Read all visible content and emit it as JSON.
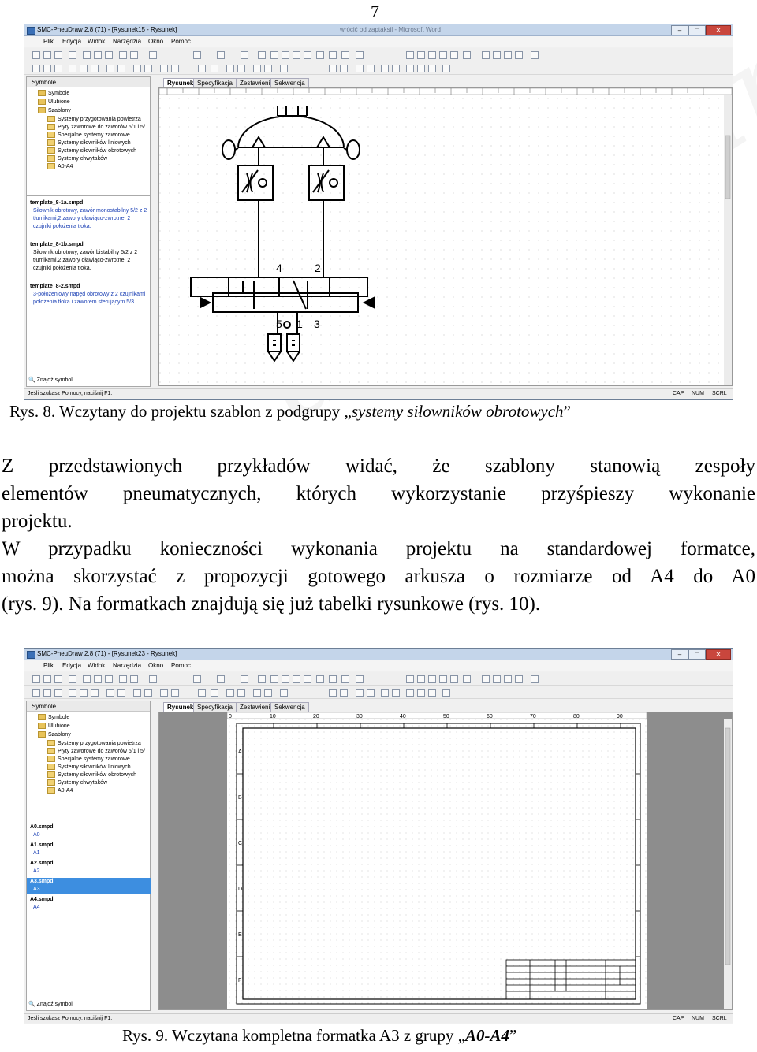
{
  "page_number": "7",
  "watermark": "abybaniarek",
  "figure1": {
    "title": "SMC-PneuDraw 2.8 (71) - [Rysunek15 - Rysunek]",
    "title_blurred": "wrócić od zaptaksil - Microsoft Word",
    "window_buttons": [
      "–",
      "□",
      "✕"
    ],
    "menu": [
      "Plik",
      "Edycja",
      "Widok",
      "Narzędzia",
      "Okno",
      "Pomoc"
    ],
    "panel_header": "Symbole",
    "tree_roots": [
      "Symbole",
      "Ulubione",
      "Szablony"
    ],
    "tree_children": [
      "Systemy przygotowania powietrza",
      "Płyty zaworowe do zaworów 5/1 i 5/",
      "Specjalne systemy zaworowe",
      "Systemy siłowników liniowych",
      "Systemy siłowników obrotowych",
      "Systemy chwytaków",
      "A0-A4"
    ],
    "templates": [
      {
        "file": "template_8-1a.smpd",
        "desc": "Siłownik obrotowy, zawór monostabilny 5/2 z 2 tłumikami,2 zawory dławiąco-zwrotne, 2 czujniki położenia tłoka."
      },
      {
        "file": "template_8-1b.smpd",
        "desc": "Siłownik obrotowy, zawór bistabilny 5/2 z 2 tłumikami,2 zawory dławiąco-zwrotne, 2 czujniki położenia tłoka."
      },
      {
        "file": "template_8-2.smpd",
        "desc": "3-położeniowy napęd obrotowy z 2 czujnikami położenia tłoka i zaworem sterującym 5/3."
      }
    ],
    "tabs": [
      "Rysunek",
      "Specyfikacja",
      "Zestawienie",
      "Sekwencja"
    ],
    "find_symbol": "Znajdź symbol",
    "status_help": "Jeśli szukasz Pomocy, naciśnij F1.",
    "status_flags": [
      "CAP",
      "NUM",
      "SCRL"
    ],
    "port_labels": {
      "p4": "4",
      "p2": "2",
      "p5": "5",
      "p1": "1",
      "p3": "3"
    }
  },
  "caption1": {
    "prefix": "Rys. 8. Wczytany do projektu szablon z podgrupy ",
    "open_quote": "„",
    "italic": "systemy siłowników obrotowych",
    "close_quote": "”"
  },
  "paragraph": {
    "lines": [
      "Z przedstawionych przykładów widać, że szablony stanowią zespoły",
      "elementów pneumatycznych, których wykorzystanie przyśpieszy wykonanie",
      "projektu.",
      "W przypadku konieczności wykonania projektu na standardowej formatce,",
      "można skorzystać z propozycji gotowego arkusza o rozmiarze od A4 do A0",
      "(rys. 9). Na formatkach znajdują się już tabelki rysunkowe (rys. 10)."
    ]
  },
  "figure2": {
    "title": "SMC-PneuDraw 2.8 (71) - [Rysunek23 - Rysunek]",
    "window_buttons": [
      "–",
      "□",
      "✕"
    ],
    "menu": [
      "Plik",
      "Edycja",
      "Widok",
      "Narzędzia",
      "Okno",
      "Pomoc"
    ],
    "panel_header": "Symbole",
    "tree_roots": [
      "Symbole",
      "Ulubione",
      "Szablony"
    ],
    "tree_children": [
      "Systemy przygotowania powietrza",
      "Płyty zaworowe do zaworów 5/1 i 5/",
      "Specjalne systemy zaworowe",
      "Systemy siłowników liniowych",
      "Systemy siłowników obrotowych",
      "Systemy chwytaków",
      "A0-A4"
    ],
    "sheets": [
      {
        "file": "A0.smpd",
        "desc": "A0",
        "selected": false
      },
      {
        "file": "A1.smpd",
        "desc": "A1",
        "selected": false
      },
      {
        "file": "A2.smpd",
        "desc": "A2",
        "selected": false
      },
      {
        "file": "A3.smpd",
        "desc": "A3",
        "selected": true
      },
      {
        "file": "A4.smpd",
        "desc": "A4",
        "selected": false
      }
    ],
    "tabs": [
      "Rysunek",
      "Specyfikacja",
      "Zestawienie",
      "Sekwencja"
    ],
    "ruler_numbers": [
      "0",
      "10",
      "20",
      "30",
      "40",
      "50",
      "60",
      "70",
      "80",
      "90"
    ],
    "row_letters": [
      "A",
      "B",
      "C",
      "D",
      "E",
      "F"
    ],
    "find_symbol": "Znajdź symbol",
    "status_help": "Jeśli szukasz Pomocy, naciśnij F1.",
    "status_flags": [
      "CAP",
      "NUM",
      "SCRL"
    ]
  },
  "caption2": {
    "prefix": "Rys. 9. Wczytana kompletna formatka A3 z grupy ",
    "open_quote": "„",
    "italic": "A0-A4",
    "close_quote": "”"
  },
  "colors": {
    "selection": "#3d8ee0",
    "titlebar": "#c4d5ea",
    "link_text": "#1a3fb4"
  }
}
